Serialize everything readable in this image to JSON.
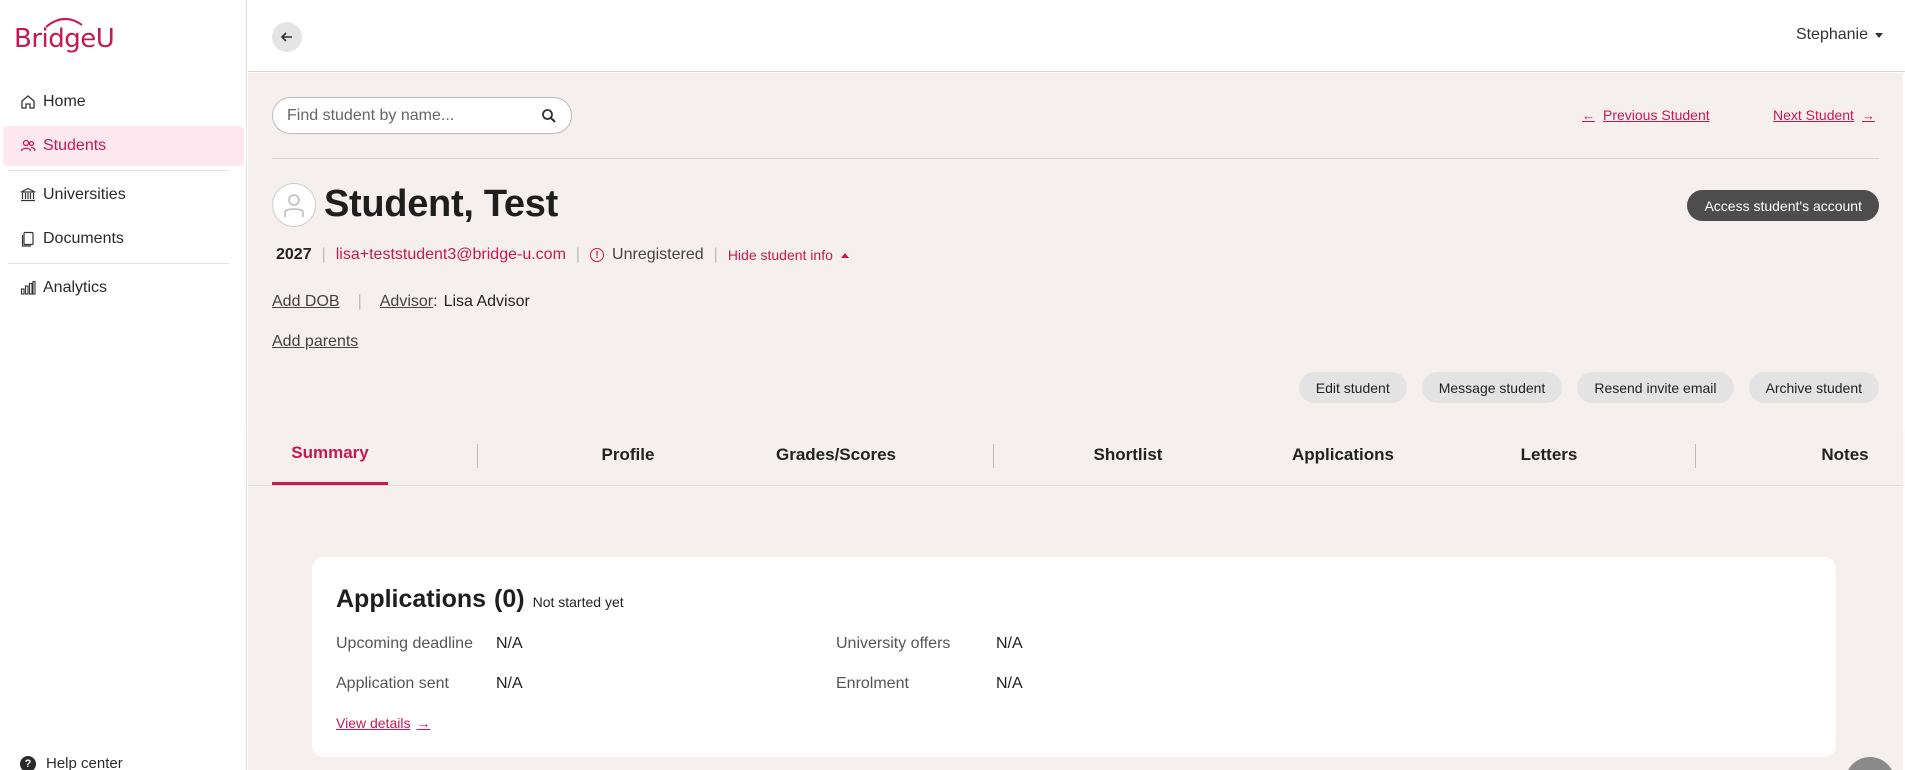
{
  "brand": {
    "name": "BridgeU",
    "color": "#c8194f"
  },
  "sidebar": {
    "items": [
      {
        "label": "Home",
        "icon": "home-icon",
        "active": false
      },
      {
        "label": "Students",
        "icon": "users-icon",
        "active": true
      },
      {
        "label": "Universities",
        "icon": "university-icon",
        "active": false
      },
      {
        "label": "Documents",
        "icon": "document-icon",
        "active": false
      },
      {
        "label": "Analytics",
        "icon": "chart-icon",
        "active": false
      }
    ],
    "help": "Help center"
  },
  "header": {
    "user": "Stephanie"
  },
  "search": {
    "placeholder": "Find student by name..."
  },
  "navigation": {
    "previous": "Previous Student",
    "next": "Next Student"
  },
  "student": {
    "name": "Student, Test",
    "year": "2027",
    "email": "lisa+teststudent3@bridge-u.com",
    "status": "Unregistered",
    "hide_info": "Hide student info",
    "add_dob": "Add DOB",
    "advisor_label": "Advisor",
    "advisor_name": "Lisa Advisor",
    "add_parents": "Add parents",
    "access_account": "Access student's account"
  },
  "actions": {
    "edit": "Edit student",
    "message": "Message student",
    "resend": "Resend invite email",
    "archive": "Archive student"
  },
  "tabs": [
    "Summary",
    "Profile",
    "Grades/Scores",
    "Shortlist",
    "Applications",
    "Letters",
    "Notes"
  ],
  "applications_card": {
    "title": "Applications",
    "count": "(0)",
    "status": "Not started yet",
    "fields": {
      "upcoming_deadline": {
        "label": "Upcoming deadline",
        "value": "N/A"
      },
      "application_sent": {
        "label": "Application sent",
        "value": "N/A"
      },
      "university_offers": {
        "label": "University offers",
        "value": "N/A"
      },
      "enrolment": {
        "label": "Enrolment",
        "value": "N/A"
      }
    },
    "view_details": "View details"
  }
}
